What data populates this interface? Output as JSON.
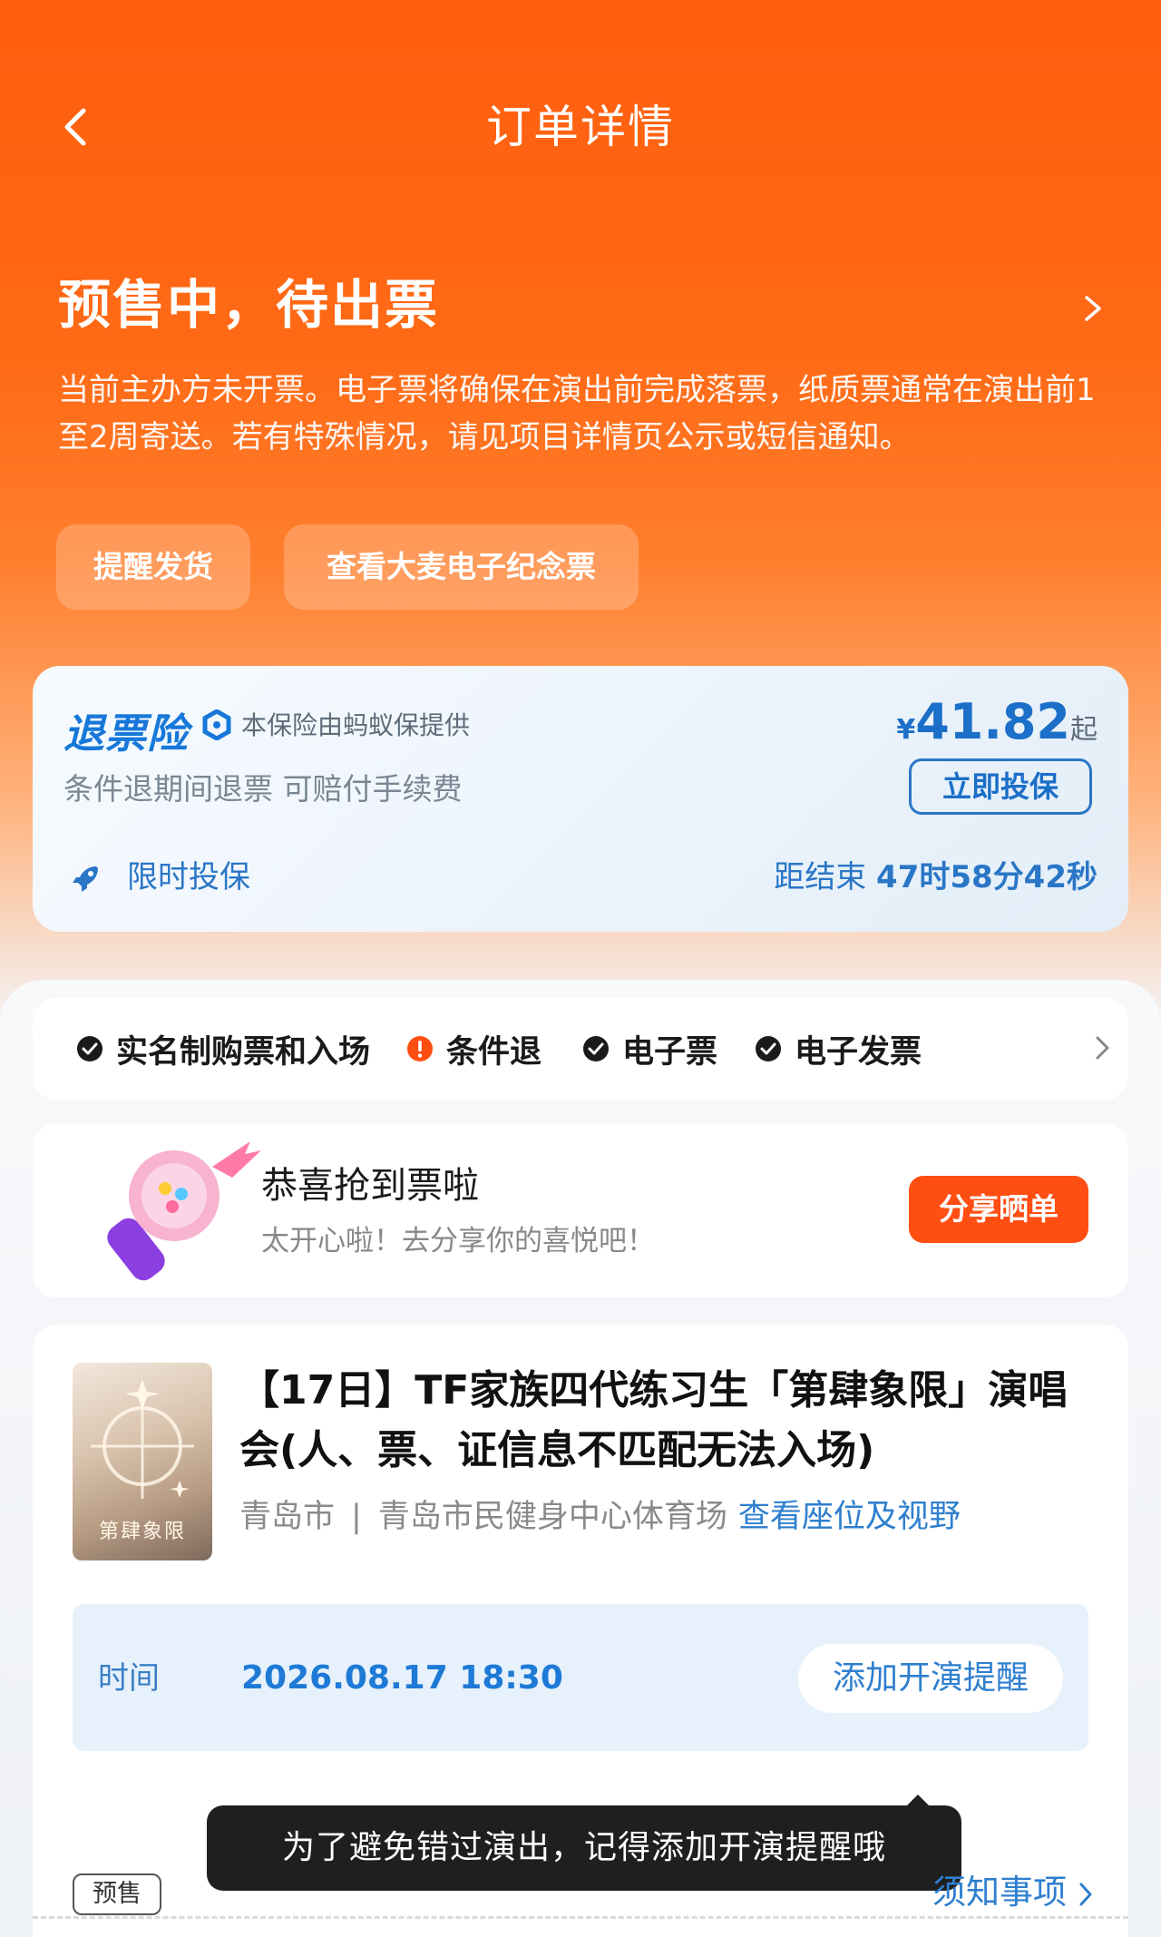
{
  "nav": {
    "title": "订单详情"
  },
  "status": {
    "title": "预售中，待出票",
    "description": "当前主办方未开票。电子票将确保在演出前完成落票，纸质票通常在演出前1至2周寄送。若有特殊情况，请见项目详情页公示或短信通知。"
  },
  "actions": {
    "remind_ship": "提醒发货",
    "view_souvenir": "查看大麦电子纪念票"
  },
  "insurance": {
    "title": "退票险",
    "provider": "本保险由蚂蚁保提供",
    "subtitle": "条件退期间退票 可赔付手续费",
    "currency": "¥",
    "price": "41.82",
    "price_suffix": "起",
    "button": "立即投保",
    "limited_label": "限时投保",
    "countdown_prefix": "距结束",
    "countdown_value": "47时58分42秒",
    "accent_color": "#1b6fc8"
  },
  "features": {
    "items": [
      {
        "label": "实名制购票和入场",
        "icon": "check-circle-icon"
      },
      {
        "label": "条件退",
        "icon": "warning-circle-icon"
      },
      {
        "label": "电子票",
        "icon": "check-circle-icon"
      },
      {
        "label": "电子发票",
        "icon": "check-circle-icon"
      }
    ]
  },
  "share": {
    "title": "恭喜抢到票啦",
    "subtitle": "太开心啦！去分享你的喜悦吧！",
    "button": "分享晒单",
    "button_color": "#ff4e12"
  },
  "show": {
    "title": "【17日】TF家族四代练习生「第肆象限」演唱会(人、票、证信息不匹配无法入场)",
    "city": "青岛市",
    "separator": "|",
    "venue": "青岛市民健身中心体育场",
    "seat_link": "查看座位及视野",
    "time_label": "时间",
    "time_value": "2026.08.17 18:30",
    "remind_button": "添加开演提醒",
    "tooltip": "为了避免错过演出，记得添加开演提醒哦",
    "badge": "预售",
    "notice_link": "须知事项",
    "poster_title": "第肆象限"
  },
  "colors": {
    "brand_orange": "#ff5d0e",
    "link_blue": "#2e7fcf"
  }
}
